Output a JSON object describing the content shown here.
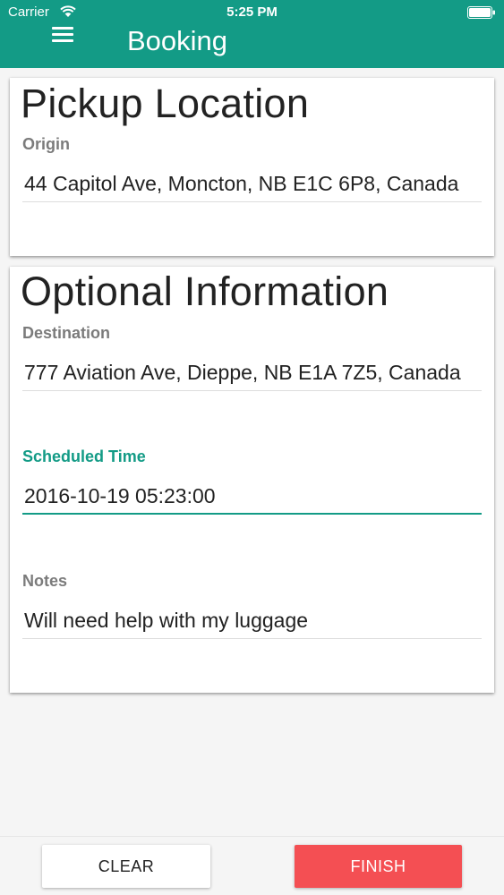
{
  "status_bar": {
    "carrier": "Carrier",
    "time": "5:25 PM"
  },
  "header": {
    "title": "Booking",
    "background_color": "#139b86",
    "menu_icon": "hamburger-menu-icon"
  },
  "pickup": {
    "title": "Pickup Location",
    "origin_label": "Origin",
    "origin_value": "44 Capitol Ave, Moncton, NB E1C 6P8, Canada"
  },
  "optional": {
    "title": "Optional Information",
    "destination_label": "Destination",
    "destination_value": "777 Aviation Ave, Dieppe, NB E1A 7Z5, Canada",
    "scheduled_time_label": "Scheduled Time",
    "scheduled_time_value": "2016-10-19 05:23:00",
    "notes_label": "Notes",
    "notes_value": "Will need help with my luggage"
  },
  "actions": {
    "clear_label": "CLEAR",
    "finish_label": "FINISH",
    "finish_color": "#f44f53"
  },
  "colors": {
    "accent": "#139b86",
    "label_gray": "#7b7b7b",
    "background": "#f5f5f5"
  }
}
